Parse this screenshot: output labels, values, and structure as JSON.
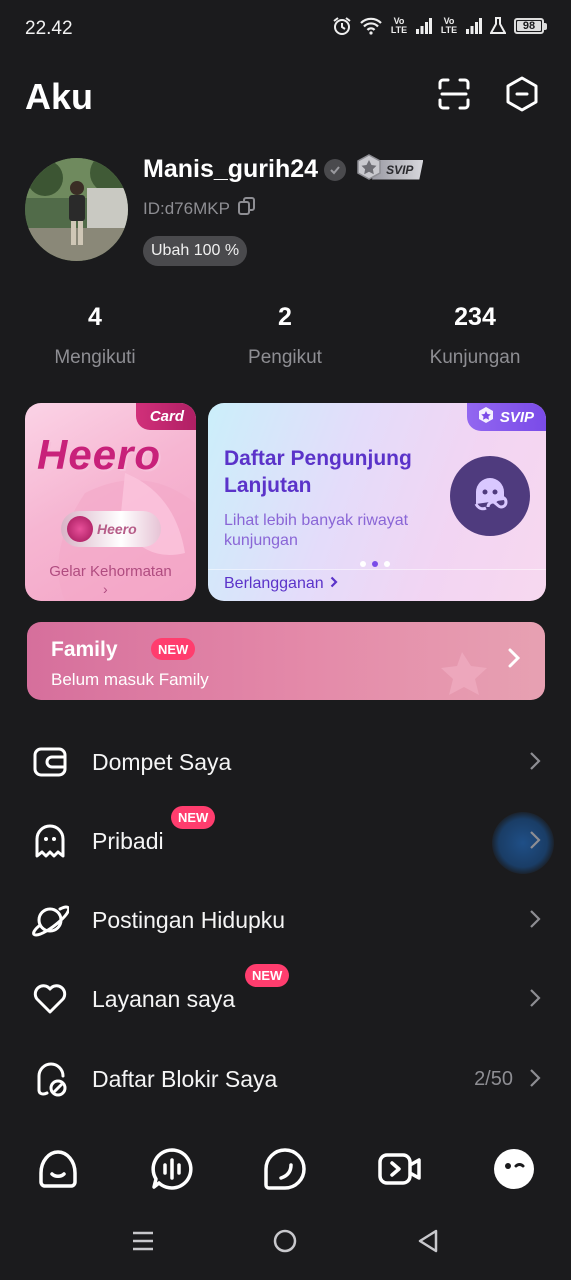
{
  "status_bar": {
    "time": "22.42",
    "volte_1": "Vo LTE",
    "volte_2": "Vo LTE",
    "battery": "98",
    "battery_level": 0.98
  },
  "header": {
    "title": "Aku",
    "icons": [
      "scan-icon",
      "settings-hexagon-icon"
    ]
  },
  "profile": {
    "username": "Manis_gurih24",
    "badge_label": "SVIP",
    "user_id": "ID:d76MKP",
    "edit_chip": "Ubah 100 %"
  },
  "stats": [
    {
      "value": "4",
      "label": "Mengikuti"
    },
    {
      "value": "2",
      "label": "Pengikut"
    },
    {
      "value": "234",
      "label": "Kunjungan"
    }
  ],
  "cards": {
    "heero": {
      "tag": "Card",
      "big_text": "Heero",
      "logo_text": "Heero",
      "caption": "Gelar Kehormatan",
      "chevron": "›"
    },
    "svip": {
      "tag": "SVIP",
      "title": "Daftar Pengunjung Lanjutan",
      "description": "Lihat lebih banyak riwayat kunjungan",
      "link": "Berlangganan",
      "carousel_active_index": 1
    }
  },
  "family": {
    "title": "Family",
    "new_badge": "NEW",
    "subtitle": "Belum masuk Family"
  },
  "menu": [
    {
      "label": "Dompet Saya",
      "icon": "wallet-icon",
      "new": "",
      "value": ""
    },
    {
      "label": "Pribadi",
      "icon": "ghost-icon",
      "new": "NEW",
      "value": ""
    },
    {
      "label": "Postingan Hidupku",
      "icon": "planet-icon",
      "new": "",
      "value": ""
    },
    {
      "label": "Layanan saya",
      "icon": "heart-icon",
      "new": "NEW",
      "value": ""
    },
    {
      "label": "Daftar Blokir Saya",
      "icon": "block-user-icon",
      "new": "",
      "value": "2/50"
    }
  ],
  "bottom_nav": [
    "home-face-icon",
    "voice-chat-icon",
    "moment-icon",
    "video-icon",
    "profile-face-icon"
  ],
  "colors": {
    "background": "#1b1b1d",
    "accent_new": "#ff3d6e",
    "svip_purple": "#5b33c9",
    "heero_pink": "#c8217a"
  }
}
